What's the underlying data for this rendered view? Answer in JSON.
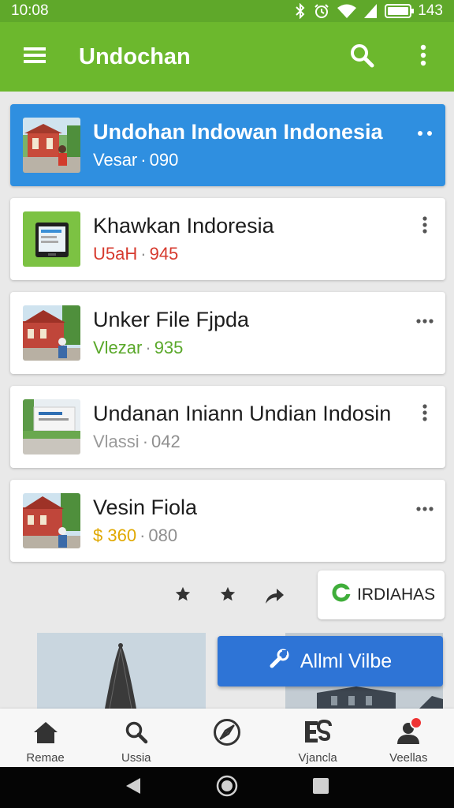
{
  "status_bar": {
    "time": "10:08",
    "battery": "143"
  },
  "app_bar": {
    "title": "Undochan"
  },
  "items": [
    {
      "title": "Undohan Indowan Indonesia",
      "price": "Vesar",
      "code": "090",
      "price_color": "#ffffff",
      "active": true,
      "more": "horizontal"
    },
    {
      "title": "Khawkan Indoresia",
      "price": "U5aH",
      "code": "945",
      "price_color": "#d63a2e",
      "active": false,
      "more": "vertical"
    },
    {
      "title": "Unker File Fjpda",
      "price": "Vlezar",
      "code": "935",
      "price_color": "#5aa82a",
      "active": false,
      "more": "horizontal"
    },
    {
      "title": "Undanan Iniann Undian Indosin",
      "price": "Vlassi",
      "code": "042",
      "price_color": "#9a9a9a",
      "active": false,
      "more": "vertical"
    },
    {
      "title": "Vesin Fiola",
      "price": "$ 360",
      "code": "080",
      "price_color": "#e0a800",
      "active": false,
      "more": "horizontal"
    }
  ],
  "separator": "·",
  "actions": {
    "brand_label": "IRDIAHAS"
  },
  "cta": {
    "label": "Allml Vilbe"
  },
  "bottom_nav": [
    {
      "label": "Remae",
      "icon": "home-icon"
    },
    {
      "label": "Ussia",
      "icon": "search-icon"
    },
    {
      "label": "",
      "icon": "compass-icon"
    },
    {
      "label": "Vjancla",
      "icon": "es-logo-icon"
    },
    {
      "label": "Veellas",
      "icon": "profile-icon"
    }
  ],
  "colors": {
    "primary": "#6cb82d",
    "accent": "#2f8fe0",
    "cta": "#2e74d6"
  }
}
